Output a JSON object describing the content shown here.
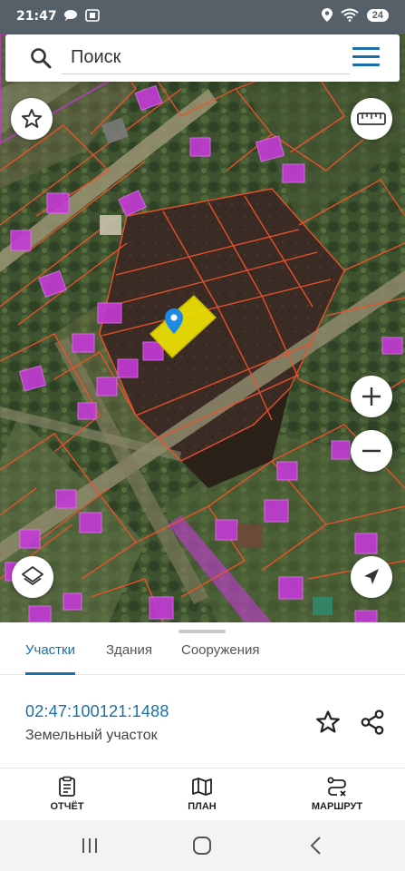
{
  "status": {
    "time": "21:47",
    "battery": "24",
    "left_icons": [
      "chat-bubble-icon",
      "screenshot-icon"
    ],
    "right_icons": [
      "location-icon",
      "wifi-icon",
      "battery-icon"
    ]
  },
  "search": {
    "placeholder": "Поиск"
  },
  "map": {
    "controls": [
      "favorite-star",
      "ruler",
      "zoom-in",
      "zoom-out",
      "layers",
      "my-location"
    ],
    "marker_color": "#1e88e5",
    "selected_parcel_color": "#f2e600",
    "parcel_border_color": "#f0522b",
    "building_color": "#c43ad6"
  },
  "tabs": [
    {
      "label": "Участки",
      "active": true
    },
    {
      "label": "Здания",
      "active": false
    },
    {
      "label": "Сооружения",
      "active": false
    }
  ],
  "parcel": {
    "cadastral_number": "02:47:100121:1488",
    "type": "Земельный участок"
  },
  "bottom_nav": [
    {
      "label": "ОТЧЁТ",
      "icon": "report-icon"
    },
    {
      "label": "ПЛАН",
      "icon": "map-icon"
    },
    {
      "label": "МАРШРУТ",
      "icon": "route-icon"
    }
  ],
  "accent_color": "#1a6fa8"
}
